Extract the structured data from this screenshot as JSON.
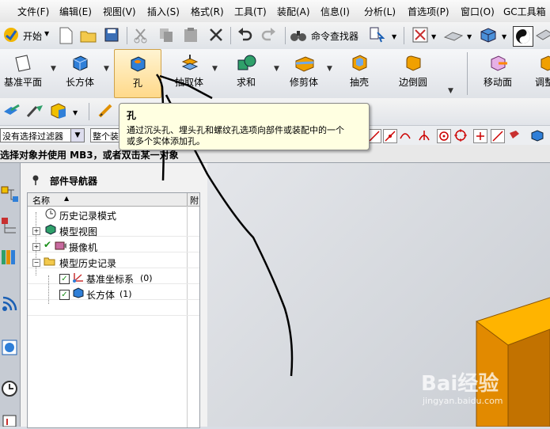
{
  "menubar": {
    "items": [
      "文件(F)",
      "编辑(E)",
      "视图(V)",
      "插入(S)",
      "格式(R)",
      "工具(T)",
      "装配(A)",
      "信息(I)",
      "分析(L)",
      "首选项(P)",
      "窗口(O)",
      "GC工具箱"
    ]
  },
  "toolbar1": {
    "start_label": "开始",
    "command_finder_label": "命令查找器"
  },
  "feature_toolbar": {
    "buttons": [
      "基准平面",
      "长方体",
      "孔",
      "抽取体",
      "求和",
      "修剪体",
      "抽壳",
      "边倒圆",
      "移动面",
      "调整"
    ]
  },
  "tooltip": {
    "title": "孔",
    "body_line1": "通过沉头孔、埋头孔和螺纹孔选项向部件或装配中的一个",
    "body_line2": "或多个实体添加孔。"
  },
  "filterbar": {
    "filter_value": "没有选择过滤器",
    "scope_value": "整个装"
  },
  "statusbar": {
    "prompt": "选择对象并使用 MB3，或者双击某一对象"
  },
  "navigator": {
    "title": "部件导航器",
    "col_name": "名称",
    "col_extra": "附",
    "rows": [
      {
        "label": "历史记录模式"
      },
      {
        "label": "模型视图"
      },
      {
        "label": "摄像机"
      },
      {
        "label": "模型历史记录"
      },
      {
        "label": "基准坐标系",
        "suffix": "(0)"
      },
      {
        "label": "长方体",
        "suffix": "(1)"
      }
    ]
  },
  "watermark": {
    "brand": "Bai经验",
    "site": "jingyan.baidu.com"
  },
  "colors": {
    "accent_orange": "#f0a000",
    "box_face": "#e28a00",
    "box_top": "#ffb400",
    "tooltip_bg": "#ffffe1"
  }
}
